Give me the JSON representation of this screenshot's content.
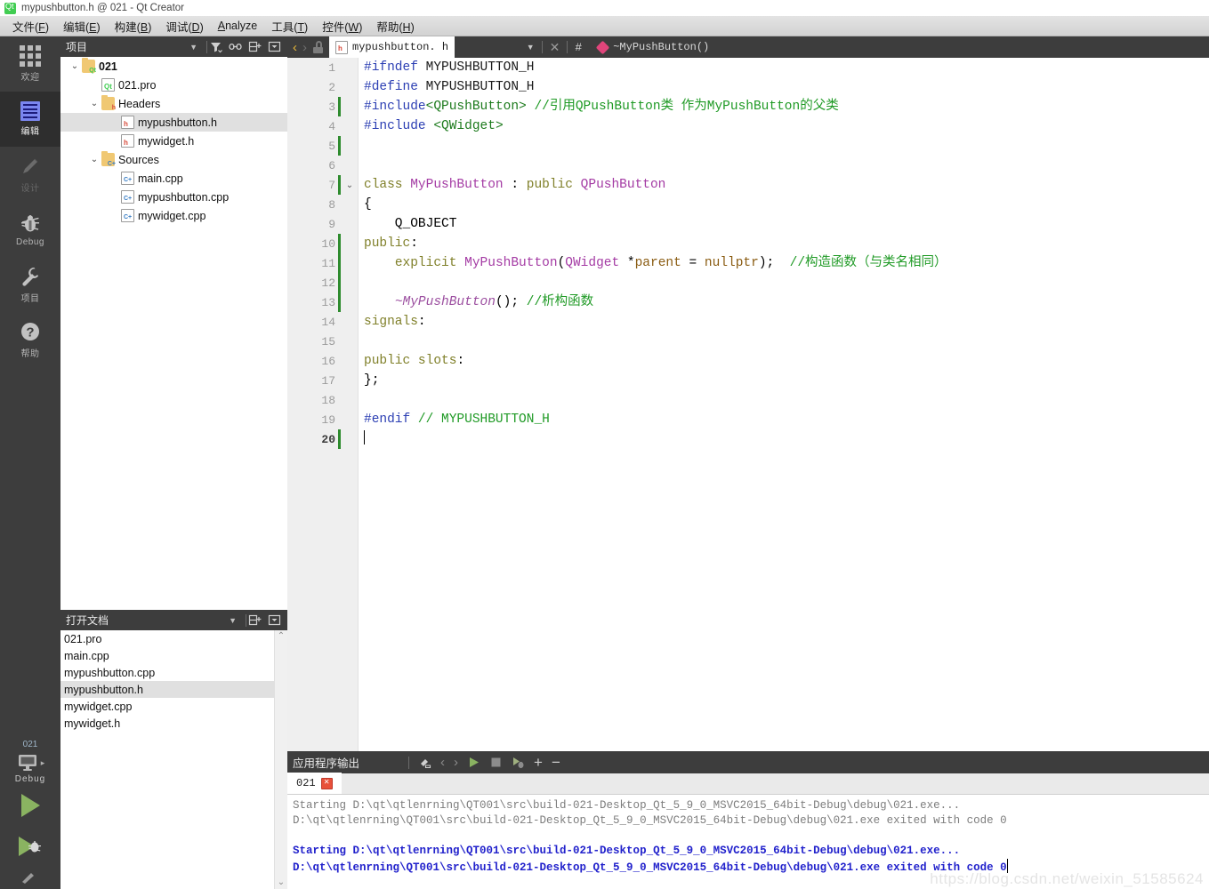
{
  "window": {
    "title": "mypushbutton.h @ 021 - Qt Creator",
    "app_icon": "qt-logo-icon"
  },
  "menubar": {
    "items": [
      {
        "label": "文件(F)",
        "mnemonic": "F"
      },
      {
        "label": "编辑(E)",
        "mnemonic": "E"
      },
      {
        "label": "构建(B)",
        "mnemonic": "B"
      },
      {
        "label": "调试(D)",
        "mnemonic": "D"
      },
      {
        "label": "Analyze",
        "mnemonic": "A"
      },
      {
        "label": "工具(T)",
        "mnemonic": "T"
      },
      {
        "label": "控件(W)",
        "mnemonic": "W"
      },
      {
        "label": "帮助(H)",
        "mnemonic": "H"
      }
    ]
  },
  "modebar": {
    "items": [
      {
        "label": "欢迎",
        "icon": "grid-icon",
        "state": "normal"
      },
      {
        "label": "编辑",
        "icon": "document-icon",
        "state": "active"
      },
      {
        "label": "设计",
        "icon": "pencil-icon",
        "state": "disabled"
      },
      {
        "label": "Debug",
        "icon": "bug-icon",
        "state": "normal"
      },
      {
        "label": "项目",
        "icon": "wrench-icon",
        "state": "normal"
      },
      {
        "label": "帮助",
        "icon": "question-icon",
        "state": "normal"
      }
    ],
    "kit": {
      "project": "021",
      "build_config": "Debug",
      "target_icon": "monitor-icon",
      "run_icon": "run-triangle-icon",
      "debug_icon": "run-debug-icon",
      "build_icon": "hammer-icon"
    }
  },
  "project_dock": {
    "title": "项目",
    "tools": [
      "filter-icon",
      "link-icon",
      "split-icon",
      "close-icon"
    ],
    "tree": [
      {
        "label": "021",
        "depth": 0,
        "twisty": "open",
        "icon": "folder-qt-icon",
        "bold": true,
        "selected": false
      },
      {
        "label": "021.pro",
        "depth": 1,
        "twisty": "none",
        "icon": "file-qt-icon",
        "bold": false,
        "selected": false
      },
      {
        "label": "Headers",
        "depth": 1,
        "twisty": "open",
        "icon": "folder-h-icon",
        "bold": false,
        "selected": false
      },
      {
        "label": "mypushbutton.h",
        "depth": 2,
        "twisty": "none",
        "icon": "file-h-icon",
        "bold": false,
        "selected": true
      },
      {
        "label": "mywidget.h",
        "depth": 2,
        "twisty": "none",
        "icon": "file-h-icon",
        "bold": false,
        "selected": false
      },
      {
        "label": "Sources",
        "depth": 1,
        "twisty": "open",
        "icon": "folder-cpp-icon",
        "bold": false,
        "selected": false
      },
      {
        "label": "main.cpp",
        "depth": 2,
        "twisty": "none",
        "icon": "file-cpp-icon",
        "bold": false,
        "selected": false
      },
      {
        "label": "mypushbutton.cpp",
        "depth": 2,
        "twisty": "none",
        "icon": "file-cpp-icon",
        "bold": false,
        "selected": false
      },
      {
        "label": "mywidget.cpp",
        "depth": 2,
        "twisty": "none",
        "icon": "file-cpp-icon",
        "bold": false,
        "selected": false
      }
    ]
  },
  "opendocs_dock": {
    "title": "打开文档",
    "tools": [
      "split-icon",
      "close-icon"
    ],
    "documents": [
      {
        "label": "021.pro",
        "selected": false
      },
      {
        "label": "main.cpp",
        "selected": false
      },
      {
        "label": "mypushbutton.cpp",
        "selected": false
      },
      {
        "label": "mypushbutton.h",
        "selected": true
      },
      {
        "label": "mywidget.cpp",
        "selected": false
      },
      {
        "label": "mywidget.h",
        "selected": false
      }
    ]
  },
  "editor": {
    "toolbar": {
      "back_icon": "chevron-left-icon",
      "forward_icon": "chevron-right-icon",
      "lock_icon": "unlocked-icon",
      "file_icon": "file-h-icon",
      "filename": "mypushbutton. h",
      "dropdown_icon": "chevron-down-icon",
      "close_icon": "close-icon",
      "hash_icon": "#",
      "symbol_icon": "diamond-icon",
      "symbol_name": "~MyPushButton()"
    },
    "lines": [
      {
        "n": 1,
        "changed": false,
        "fold": "",
        "current": false,
        "tokens": [
          {
            "t": "#ifndef ",
            "c": "k-pre"
          },
          {
            "t": "MYPUSHBUTTON_H",
            "c": "k-def"
          }
        ]
      },
      {
        "n": 2,
        "changed": false,
        "fold": "",
        "current": false,
        "tokens": [
          {
            "t": "#define ",
            "c": "k-pre"
          },
          {
            "t": "MYPUSHBUTTON_H",
            "c": "k-def"
          }
        ]
      },
      {
        "n": 3,
        "changed": true,
        "fold": "",
        "current": false,
        "tokens": [
          {
            "t": "#include",
            "c": "k-pre"
          },
          {
            "t": "<QPushButton>",
            "c": "k-inc"
          },
          {
            "t": " ",
            "c": "k-plain"
          },
          {
            "t": "//引用QPushButton类 作为MyPushButton的父类",
            "c": "k-cmt"
          }
        ]
      },
      {
        "n": 4,
        "changed": false,
        "fold": "",
        "current": false,
        "tokens": [
          {
            "t": "#include ",
            "c": "k-pre"
          },
          {
            "t": "<QWidget>",
            "c": "k-inc"
          }
        ]
      },
      {
        "n": 5,
        "changed": true,
        "fold": "",
        "current": false,
        "tokens": []
      },
      {
        "n": 6,
        "changed": false,
        "fold": "",
        "current": false,
        "tokens": []
      },
      {
        "n": 7,
        "changed": true,
        "fold": "down",
        "current": false,
        "tokens": [
          {
            "t": "class",
            "c": "k-kw"
          },
          {
            "t": " ",
            "c": "k-plain"
          },
          {
            "t": "MyPushButton",
            "c": "k-typ"
          },
          {
            "t": " : ",
            "c": "k-plain"
          },
          {
            "t": "public",
            "c": "k-kw"
          },
          {
            "t": " ",
            "c": "k-plain"
          },
          {
            "t": "QPushButton",
            "c": "k-typ"
          }
        ]
      },
      {
        "n": 8,
        "changed": false,
        "fold": "",
        "current": false,
        "tokens": [
          {
            "t": "{",
            "c": "k-plain"
          }
        ]
      },
      {
        "n": 9,
        "changed": false,
        "fold": "",
        "current": false,
        "tokens": [
          {
            "t": "    Q_OBJECT",
            "c": "k-plain"
          }
        ]
      },
      {
        "n": 10,
        "changed": true,
        "fold": "",
        "current": false,
        "tokens": [
          {
            "t": "public",
            "c": "k-kw"
          },
          {
            "t": ":",
            "c": "k-plain"
          }
        ]
      },
      {
        "n": 11,
        "changed": true,
        "fold": "",
        "current": false,
        "tokens": [
          {
            "t": "    ",
            "c": "k-plain"
          },
          {
            "t": "explicit",
            "c": "k-kw"
          },
          {
            "t": " ",
            "c": "k-plain"
          },
          {
            "t": "MyPushButton",
            "c": "k-typ"
          },
          {
            "t": "(",
            "c": "k-plain"
          },
          {
            "t": "QWidget",
            "c": "k-typ"
          },
          {
            "t": " *",
            "c": "k-plain"
          },
          {
            "t": "parent",
            "c": "k-var"
          },
          {
            "t": " = ",
            "c": "k-plain"
          },
          {
            "t": "nullptr",
            "c": "k-var"
          },
          {
            "t": ");  ",
            "c": "k-plain"
          },
          {
            "t": "//构造函数（与类名相同）",
            "c": "k-cmt"
          }
        ]
      },
      {
        "n": 12,
        "changed": true,
        "fold": "",
        "current": false,
        "tokens": []
      },
      {
        "n": 13,
        "changed": true,
        "fold": "",
        "current": false,
        "tokens": [
          {
            "t": "    ",
            "c": "k-plain"
          },
          {
            "t": "~MyPushButton",
            "c": "k-fn"
          },
          {
            "t": "(); ",
            "c": "k-plain"
          },
          {
            "t": "//析构函数",
            "c": "k-cmt"
          }
        ]
      },
      {
        "n": 14,
        "changed": false,
        "fold": "",
        "current": false,
        "tokens": [
          {
            "t": "signals",
            "c": "k-kw"
          },
          {
            "t": ":",
            "c": "k-plain"
          }
        ]
      },
      {
        "n": 15,
        "changed": false,
        "fold": "",
        "current": false,
        "tokens": []
      },
      {
        "n": 16,
        "changed": false,
        "fold": "",
        "current": false,
        "tokens": [
          {
            "t": "public",
            "c": "k-kw"
          },
          {
            "t": " ",
            "c": "k-plain"
          },
          {
            "t": "slots",
            "c": "k-kw"
          },
          {
            "t": ":",
            "c": "k-plain"
          }
        ]
      },
      {
        "n": 17,
        "changed": false,
        "fold": "",
        "current": false,
        "tokens": [
          {
            "t": "};",
            "c": "k-plain"
          }
        ]
      },
      {
        "n": 18,
        "changed": false,
        "fold": "",
        "current": false,
        "tokens": []
      },
      {
        "n": 19,
        "changed": false,
        "fold": "",
        "current": false,
        "tokens": [
          {
            "t": "#endif ",
            "c": "k-pre"
          },
          {
            "t": "// MYPUSHBUTTON_H",
            "c": "k-cmt"
          }
        ]
      },
      {
        "n": 20,
        "changed": true,
        "fold": "",
        "current": true,
        "tokens": []
      }
    ]
  },
  "output_pane": {
    "title": "应用程序输出",
    "tools": [
      "clear-icon",
      "prev-icon",
      "next-icon",
      "run-icon",
      "stop-icon",
      "rerun-icon",
      "zoom-in-icon",
      "zoom-out-icon"
    ],
    "tab": {
      "label": "021",
      "close_icon": "close-icon"
    },
    "lines": [
      {
        "text": "Starting D:\\qt\\qtlenrning\\QT001\\src\\build-021-Desktop_Qt_5_9_0_MSVC2015_64bit-Debug\\debug\\021.exe...",
        "style": "gray"
      },
      {
        "text": "D:\\qt\\qtlenrning\\QT001\\src\\build-021-Desktop_Qt_5_9_0_MSVC2015_64bit-Debug\\debug\\021.exe exited with code 0",
        "style": "gray"
      },
      {
        "text": "",
        "style": "gray"
      },
      {
        "text": "Starting D:\\qt\\qtlenrning\\QT001\\src\\build-021-Desktop_Qt_5_9_0_MSVC2015_64bit-Debug\\debug\\021.exe...",
        "style": "blue"
      },
      {
        "text": "D:\\qt\\qtlenrning\\QT001\\src\\build-021-Desktop_Qt_5_9_0_MSVC2015_64bit-Debug\\debug\\021.exe exited with code 0",
        "style": "blue"
      }
    ],
    "watermark": "https://blog.csdn.net/weixin_51585624"
  },
  "colors": {
    "dark_chrome": "#3d3d3d",
    "accent_green": "#41cd52",
    "selection": "#e0e0e0",
    "change_marker": "#2e8b2e",
    "output_blue": "#2222cc"
  }
}
